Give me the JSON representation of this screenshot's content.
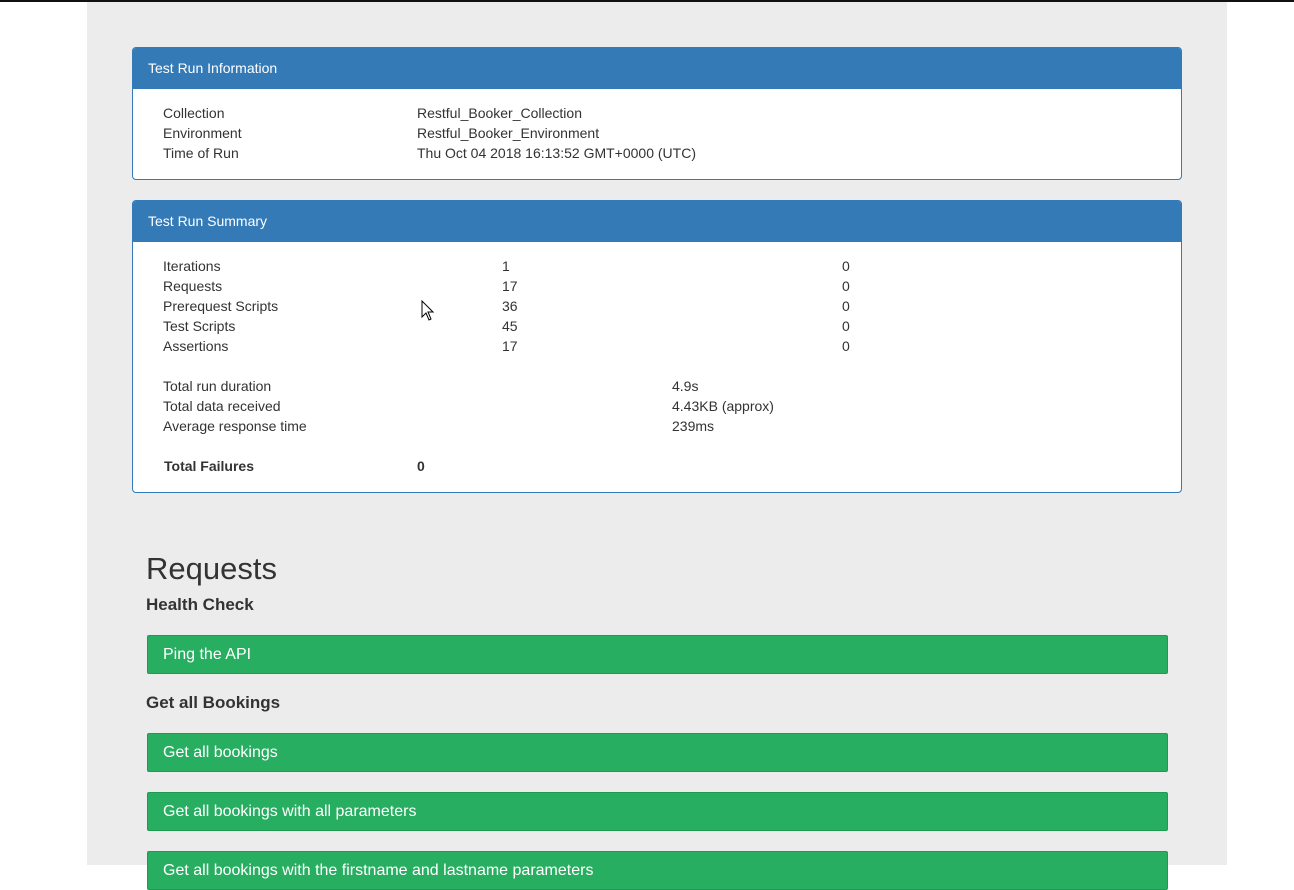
{
  "test_run_information": {
    "title": "Test Run Information",
    "rows": [
      {
        "label": "Collection",
        "value": "Restful_Booker_Collection"
      },
      {
        "label": "Environment",
        "value": "Restful_Booker_Environment"
      },
      {
        "label": "Time of Run",
        "value": "Thu Oct 04 2018 16:13:52 GMT+0000 (UTC)"
      }
    ]
  },
  "test_run_summary": {
    "title": "Test Run Summary",
    "counts": [
      {
        "label": "Iterations",
        "total": "1",
        "failed": "0"
      },
      {
        "label": "Requests",
        "total": "17",
        "failed": "0"
      },
      {
        "label": "Prerequest Scripts",
        "total": "36",
        "failed": "0"
      },
      {
        "label": "Test Scripts",
        "total": "45",
        "failed": "0"
      },
      {
        "label": "Assertions",
        "total": "17",
        "failed": "0"
      }
    ],
    "metrics": [
      {
        "label": "Total run duration",
        "value": "4.9s"
      },
      {
        "label": "Total data received",
        "value": "4.43KB (approx)"
      },
      {
        "label": "Average response time",
        "value": "239ms"
      }
    ],
    "total_failures_label": "Total Failures",
    "total_failures_value": "0"
  },
  "requests": {
    "title": "Requests",
    "groups": [
      {
        "title": "Health Check",
        "items": [
          "Ping the API"
        ]
      },
      {
        "title": "Get all Bookings",
        "items": [
          "Get all bookings",
          "Get all bookings with all parameters",
          "Get all bookings with the firstname and lastname parameters"
        ]
      }
    ]
  },
  "colors": {
    "panel_header": "#337ab7",
    "success": "#27ae60",
    "background": "#ececec"
  }
}
